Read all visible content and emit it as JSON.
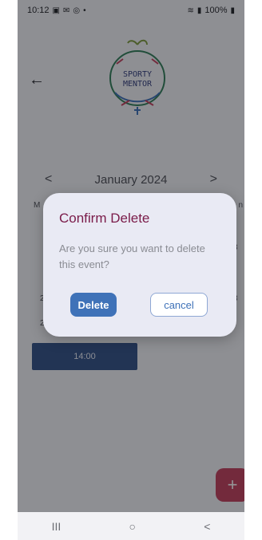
{
  "status_bar": {
    "time": "10:12",
    "left_icons": [
      "calendar-icon",
      "mail-icon",
      "instagram-icon",
      "dot-icon"
    ],
    "battery": "100%"
  },
  "logo": {
    "line1": "SPORTY",
    "line2": "MENTOR"
  },
  "calendar": {
    "month": "January 2024",
    "prev": "<",
    "next": ">",
    "weekday_first": "M",
    "weekday_last": "n",
    "peek_right_1": "3",
    "peek_right_2": "3",
    "peek_left_1": "2",
    "peek_left_2": "2"
  },
  "event": {
    "time": "14:00"
  },
  "fab": {
    "label": "+"
  },
  "dialog": {
    "title": "Confirm Delete",
    "message": "Are you sure you want to delete this event?",
    "delete_label": "Delete",
    "cancel_label": "cancel"
  },
  "nav": {
    "recents": "III",
    "home": "○",
    "back": "<"
  },
  "colors": {
    "dialog_title": "#7a1b49",
    "primary": "#3f72b8",
    "event_block": "#2f4f86",
    "fab": "#c23d5a"
  }
}
